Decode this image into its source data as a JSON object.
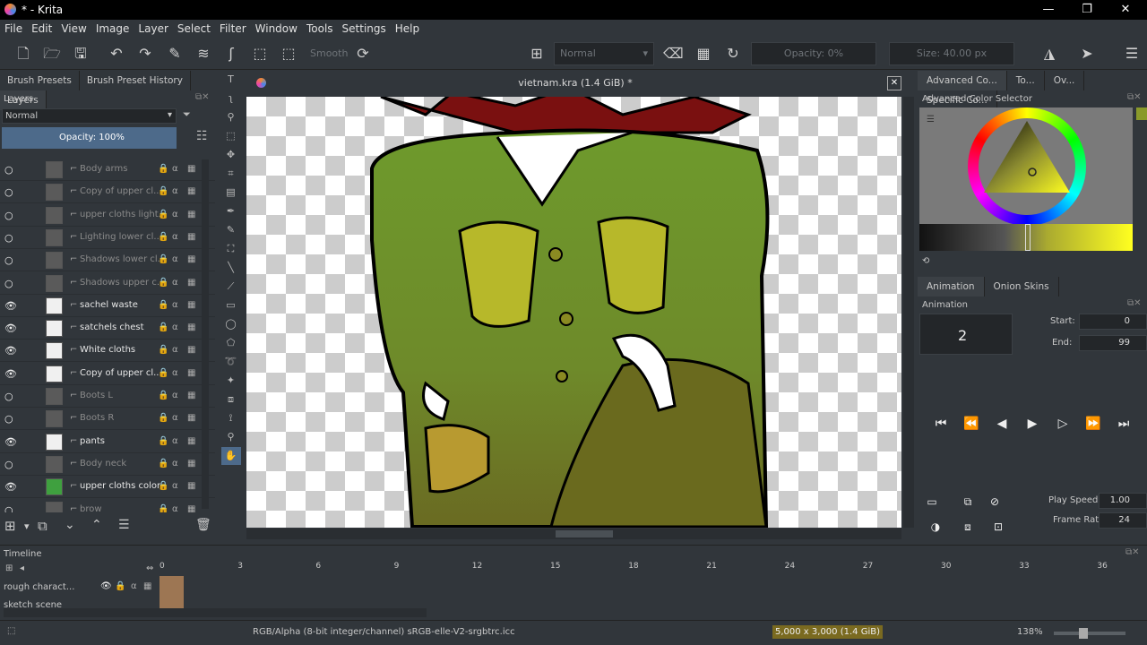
{
  "window": {
    "title": "* - Krita"
  },
  "menu": [
    "File",
    "Edit",
    "View",
    "Image",
    "Layer",
    "Select",
    "Filter",
    "Window",
    "Tools",
    "Settings",
    "Help"
  ],
  "toolbar": {
    "smooth_label": "Smooth",
    "blend_mode": "Normal",
    "opacity": "Opacity: 0%",
    "size": "Size: 40.00 px"
  },
  "left_tabs": [
    "Brush Presets",
    "Brush Preset History",
    "Layers"
  ],
  "layers_panel": {
    "title": "Layers",
    "blend_mode": "Normal",
    "opacity": "Opacity:  100%",
    "layers": [
      {
        "name": "Body arms",
        "visible": false
      },
      {
        "name": "Copy of upper cl...",
        "visible": false
      },
      {
        "name": "upper cloths light...",
        "visible": false
      },
      {
        "name": "Lighting lower cl...",
        "visible": false
      },
      {
        "name": "Shadows lower cl...",
        "visible": false
      },
      {
        "name": "Shadows upper c...",
        "visible": false
      },
      {
        "name": "sachel waste",
        "visible": true
      },
      {
        "name": "satchels chest",
        "visible": true
      },
      {
        "name": "White cloths",
        "visible": true
      },
      {
        "name": "Copy of upper cl...",
        "visible": true
      },
      {
        "name": "Boots L",
        "visible": false
      },
      {
        "name": "Boots R",
        "visible": false
      },
      {
        "name": "pants",
        "visible": true
      },
      {
        "name": "Body neck",
        "visible": false
      },
      {
        "name": "upper cloths color",
        "visible": true
      },
      {
        "name": "brow",
        "visible": false
      }
    ]
  },
  "document": {
    "title": "vietnam.kra (1.4 GiB) *"
  },
  "right_tabs": [
    "Advanced Co...",
    "To...",
    "Ov...",
    "Specific Co..."
  ],
  "color_selector": {
    "title": "Advanced Color Selector",
    "accent": "#8a9a2a"
  },
  "animation": {
    "tabs": [
      "Animation",
      "Onion Skins"
    ],
    "title": "Animation",
    "current_frame": "2",
    "start_label": "Start:",
    "start": "0",
    "end_label": "End:",
    "end": "99",
    "play_speed_label": "Play Speed:",
    "play_speed": "1.00",
    "frame_rate_label": "Frame Rate:",
    "frame_rate": "24"
  },
  "timeline": {
    "title": "Timeline",
    "ticks": [
      "0",
      "3",
      "6",
      "9",
      "12",
      "15",
      "18",
      "21",
      "24",
      "27",
      "30",
      "33",
      "36"
    ],
    "tracks": [
      "rough charact...",
      "sketch scene"
    ]
  },
  "status": {
    "color_profile": "RGB/Alpha (8-bit integer/channel)  sRGB-elle-V2-srgbtrc.icc",
    "dimensions": "5,000 x 3,000 (1.4 GiB)",
    "zoom": "138%"
  }
}
